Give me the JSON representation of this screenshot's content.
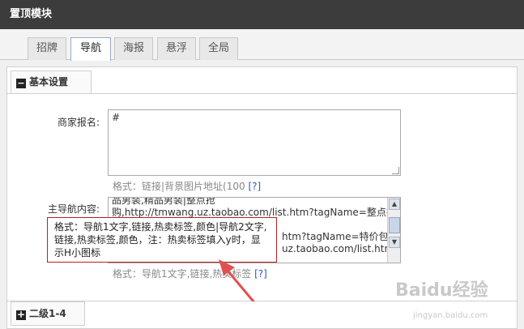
{
  "window": {
    "title": "置顶模块"
  },
  "tabs": [
    {
      "label": "招牌",
      "active": false
    },
    {
      "label": "导航",
      "active": true
    },
    {
      "label": "海报",
      "active": false
    },
    {
      "label": "悬浮",
      "active": false
    },
    {
      "label": "全局",
      "active": false
    }
  ],
  "section_basic": {
    "title": "基本设置"
  },
  "field_merchant": {
    "label": "商家报名:",
    "value": "#",
    "hint": "格式：链接|背景图片地址(100",
    "help": "[?]"
  },
  "field_nav": {
    "label": "主导航内容:",
    "lines": [
      "品男装,精品男装|整点抢",
      "购,http://tmwang.uz.taobao.com/list.htm?tagName=整点抢",
      "",
      "htm?tagName=特价包",
      "uz.taobao.com/list.htm?"
    ],
    "hint": "格式：导航1文字,链接,热卖标签",
    "help": "[?]"
  },
  "callout": {
    "text": "格式：导航1文字,链接,热卖标签,颜色|导航2文字,链接,热卖标签,颜色，注：热卖标签填入y时，显示H小图标"
  },
  "section_level2": {
    "title": "二级1-4"
  },
  "watermark": {
    "text": "Baidu经验",
    "sub": "jingyan.baidu.com"
  },
  "colors": {
    "titlebar": "#3c3c3c",
    "callout_border": "#b22222",
    "arrow": "#e05050",
    "help_link": "#2a57c8"
  }
}
